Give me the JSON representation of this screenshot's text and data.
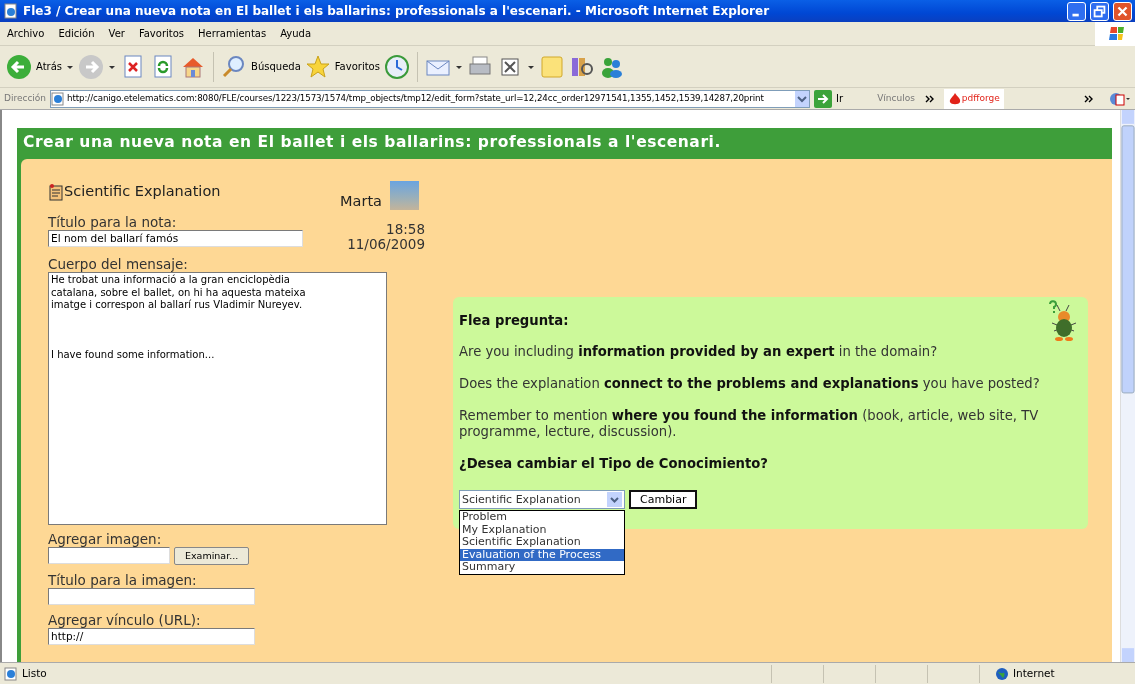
{
  "window": {
    "title": "Fle3 / Crear una nueva nota en El ballet i els ballarins: professionals a l'escenari. - Microsoft Internet Explorer"
  },
  "menu_bar": [
    "Archivo",
    "Edición",
    "Ver",
    "Favoritos",
    "Herramientas",
    "Ayuda"
  ],
  "toolbar": [
    {
      "label": "Atrás"
    },
    {
      "label": "Búsqueda"
    },
    {
      "label": "Favoritos"
    }
  ],
  "address_bar": {
    "label": "Dirección",
    "url": "http://canigo.etelematics.com:8080/FLE/courses/1223/1573/1574/tmp_objects/tmp12/edit_form?state_url=12,24cc_order12971541,1355,1452,1539,14287,20print",
    "go": "Ir",
    "links_label": "Vínculos",
    "link": "pdfforge"
  },
  "page": {
    "heading": "Crear una nueva nota en El ballet i els ballarins: professionals a l'escenari.",
    "note_type": "Scientific Explanation",
    "author": "Marta",
    "time": "18:58",
    "date": "11/06/2009",
    "title_label": "Título para la nota:",
    "title_value": "El nom del ballarí famós",
    "body_label": "Cuerpo del mensaje:",
    "body_value": "He trobat una informació a la gran enciclopèdia catalana, sobre el ballet, on hi ha aquesta mateixa imatge i correspon al ballarí rus Vladimir Nureyev.\n\n\n\nI have found some information...",
    "image_label": "Agregar imagen:",
    "browse_button": "Examinar...",
    "image_title_label": "Título para la imagen:",
    "link_label": "Agregar vínculo (URL):",
    "link_value": "http://"
  },
  "flea": {
    "title": "Flea pregunta:",
    "paragraphs": [
      "Are you including **information provided by an expert** in the domain?",
      "Does the explanation **connect to the problems and explanations** you have posted?",
      "Remember to mention **where you found the information** (book, article, web site, TV programme, lecture, discussion)."
    ],
    "question": "¿Desea cambiar el Tipo de Conocimiento?",
    "select_value": "Scientific Explanation",
    "options": [
      {
        "label": "Problem",
        "selected": false
      },
      {
        "label": "My Explanation",
        "selected": false
      },
      {
        "label": "Scientific Explanation",
        "selected": false
      },
      {
        "label": "Evaluation of the Process",
        "selected": true
      },
      {
        "label": "Summary",
        "selected": false
      }
    ],
    "button": "Cambiar"
  },
  "status_bar": {
    "text": "Listo",
    "zone": "Internet"
  }
}
